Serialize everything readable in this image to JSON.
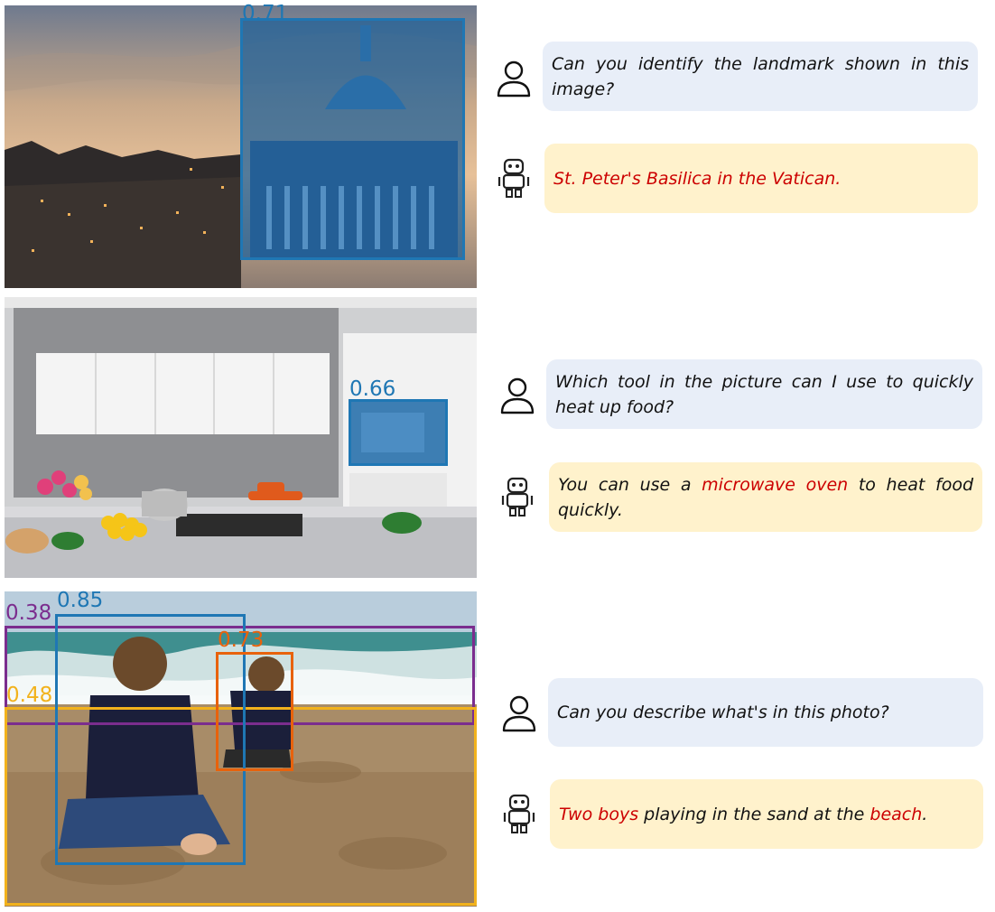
{
  "colors": {
    "box_blue": "#1f77b4",
    "box_purple": "#7b2d8e",
    "box_orange": "#e8620c",
    "box_yellow": "#f2b21c",
    "user_bubble": "#e8eef8",
    "bot_bubble": "#fff2cc",
    "highlight": "#cc0000"
  },
  "examples": [
    {
      "photo_icon": "st-peters-basilica-photo",
      "detections": [
        {
          "score": "0.71",
          "color": "blue"
        }
      ],
      "question": "Can you identify the landmark shown in this image?",
      "answer": {
        "highlight": "St. Peter's Basilica in the Vatican."
      }
    },
    {
      "photo_icon": "kitchen-photo",
      "detections": [
        {
          "score": "0.66",
          "color": "blue"
        }
      ],
      "question": "Which tool in the picture can I use to quickly heat up food?",
      "answer": {
        "pre": "You can use a ",
        "highlight": "microwave oven",
        "post": " to heat food quickly."
      }
    },
    {
      "photo_icon": "beach-boys-photo",
      "detections": [
        {
          "score": "0.38",
          "color": "purple"
        },
        {
          "score": "0.85",
          "color": "blue"
        },
        {
          "score": "0.73",
          "color": "orange"
        },
        {
          "score": "0.48",
          "color": "yellow"
        }
      ],
      "question": "Can you describe what's in this photo?",
      "answer": {
        "highlight": "Two boys",
        "mid": " playing in the sand at the ",
        "highlight2": "beach",
        "post": "."
      }
    }
  ],
  "icons": {
    "user": "person-icon",
    "bot": "robot-icon"
  }
}
